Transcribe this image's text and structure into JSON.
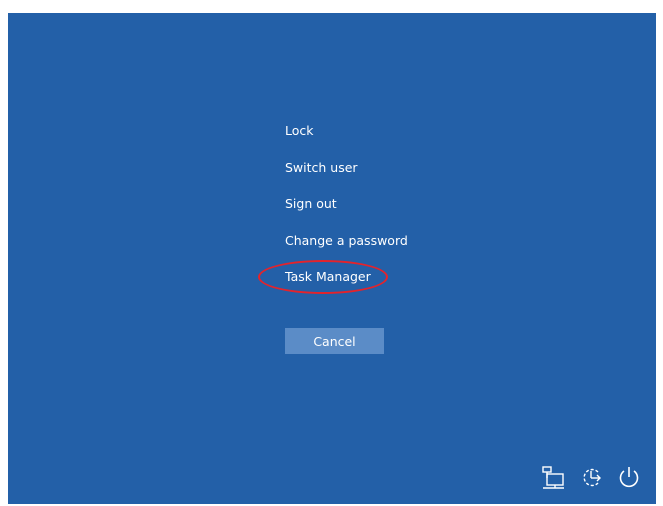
{
  "menu": {
    "items": [
      {
        "id": "lock",
        "label": "Lock"
      },
      {
        "id": "switch-user",
        "label": "Switch user"
      },
      {
        "id": "sign-out",
        "label": "Sign out"
      },
      {
        "id": "change-password",
        "label": "Change a password"
      },
      {
        "id": "task-manager",
        "label": "Task Manager"
      }
    ],
    "highlighted_item": "Task Manager"
  },
  "cancel_button": {
    "label": "Cancel"
  },
  "tray": {
    "icons": [
      "network-icon",
      "ease-of-access-icon",
      "power-icon"
    ]
  },
  "colors": {
    "background": "#2360a8",
    "cancel_button": "#5b8cc7",
    "highlight_annotation": "#e4232b",
    "text": "#ffffff"
  }
}
